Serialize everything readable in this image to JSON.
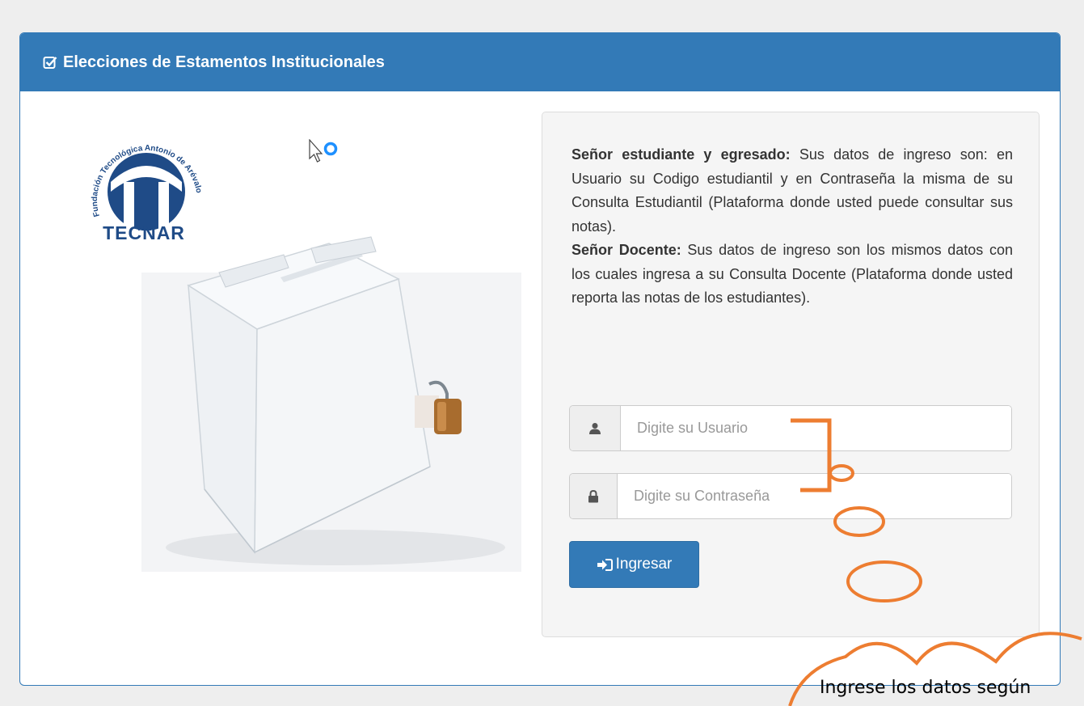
{
  "panel": {
    "title": "Elecciones de Estamentos Institucionales"
  },
  "logo": {
    "arc_text": "Fundación Tecnológica Antonio de Arévalo",
    "name": "TECNAR"
  },
  "info": {
    "student_title": "Señor estudiante y egresado:",
    "student_text": " Sus datos de ingreso son: en Usuario su Codigo estudiantil y en Contraseña la misma de su Consulta Estudiantil (Plataforma donde usted puede consultar sus notas).",
    "teacher_title": "Señor Docente:",
    "teacher_text": " Sus datos de ingreso son los mismos datos con los cuales ingresa a su Consulta Docente (Plataforma donde usted reporta las notas de los estudiantes)."
  },
  "form": {
    "user_placeholder": "Digite su Usuario",
    "user_value": "",
    "password_placeholder": "Digite su Contraseña",
    "password_value": "",
    "submit_label": "Ingresar"
  },
  "annotation": {
    "cloud_text": "Ingrese los datos según"
  },
  "icons": {
    "header": "check-square-icon",
    "user": "user-icon",
    "password": "lock-icon",
    "submit": "sign-in-icon"
  },
  "colors": {
    "primary": "#337ab7",
    "annotation": "#ed7d31",
    "logo": "#1f4b87"
  }
}
